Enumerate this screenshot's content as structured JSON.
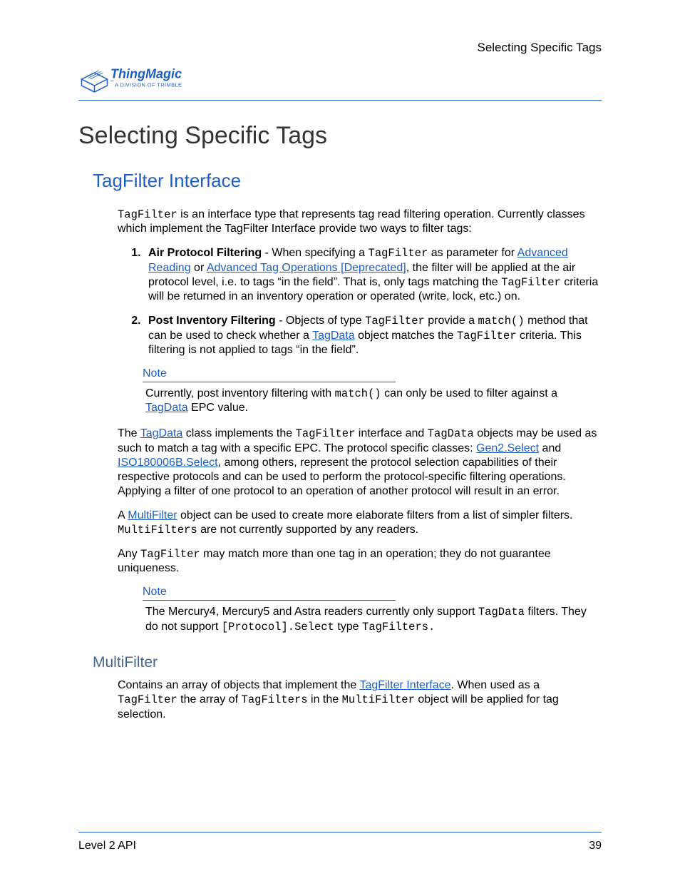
{
  "running_head": "Selecting Specific Tags",
  "logo": {
    "brand": "ThingMagic",
    "tagline": "A DIVISION OF TRIMBLE"
  },
  "title": "Selecting Specific Tags",
  "section": "TagFilter Interface",
  "intro": {
    "seg1": "TagFilter",
    "seg2": " is an interface type that represents tag read filtering operation. Currently classes which implement the TagFilter Interface provide two ways to filter tags:"
  },
  "item1": {
    "label": "Air Protocol Filtering",
    "seg1": " - When specifying a ",
    "code1": "TagFilter",
    "seg2": " as parameter for ",
    "link1": "Advanced Reading",
    "seg3": " or ",
    "link2": "Advanced Tag Operations [Deprecated]",
    "seg4": ", the filter will be applied at the air protocol level, i.e. to tags “in the field”. That is, only tags matching the ",
    "code2": "TagFilter",
    "seg5": " criteria will be returned in an inventory operation or operated (write, lock, etc.) on."
  },
  "item2": {
    "label": "Post Inventory Filtering",
    "seg1": " - Objects of type ",
    "code1": "TagFilter",
    "seg2": " provide a ",
    "code2": "match()",
    "seg3": " method that can be used to check whether a ",
    "link1": "TagData",
    "seg4": " object matches the ",
    "code3": "TagFilter",
    "seg5": " criteria. This filtering is not applied to tags “in the field”."
  },
  "note1": {
    "label": "Note",
    "body_seg1": "Currently, post inventory filtering with ",
    "body_code1": "match()",
    "body_seg2": " can only be used to filter against a ",
    "body_link1": "TagData",
    "body_seg3": " EPC value."
  },
  "p2": {
    "seg1": "The ",
    "link1": "TagData",
    "seg2": " class implements the ",
    "code1": "TagFilter",
    "seg3": " interface and ",
    "code2": "TagData",
    "seg4": " objects may be used as such to match a tag with a specific EPC. The protocol specific classes: ",
    "link2": "Gen2.Select",
    "seg5": "  and ",
    "link3": "ISO180006B.Select",
    "seg6": ", among others, represent the protocol selection capabilities of their respective protocols and can be used to perform the protocol-specific filtering operations. Applying a filter of one protocol to an operation of another protocol will result in an error."
  },
  "p3": {
    "seg1": "A ",
    "link1": "MultiFilter",
    "seg2": " object can be used to create more elaborate filters from a list of simpler filters. ",
    "code1": "MultiFilters",
    "seg3": " are not currently supported by any readers."
  },
  "p4": {
    "seg1": "Any ",
    "code1": "TagFilter",
    "seg2": " may match more than one tag in an operation; they do not guarantee uniqueness."
  },
  "note2": {
    "label": "Note",
    "body_seg1": "The Mercury4, Mercury5 and Astra readers currently only support ",
    "body_code1": "TagData",
    "body_seg2": " filters. They do not support ",
    "body_code2": "[Protocol].Select",
    "body_seg3": " type ",
    "body_code3": "TagFilters.",
    "body_seg4": ""
  },
  "subsection": "MultiFilter",
  "p5": {
    "seg1": "Contains an array of objects that implement the ",
    "link1": "TagFilter Interface",
    "seg2": ". When used as a ",
    "code1": "TagFilter",
    "seg3": " the array of ",
    "code2": "TagFilters",
    "seg4": " in the ",
    "code3": "MultiFilter",
    "seg5": " object will be applied for tag selection."
  },
  "footer": {
    "left": "Level 2 API",
    "right": "39"
  }
}
